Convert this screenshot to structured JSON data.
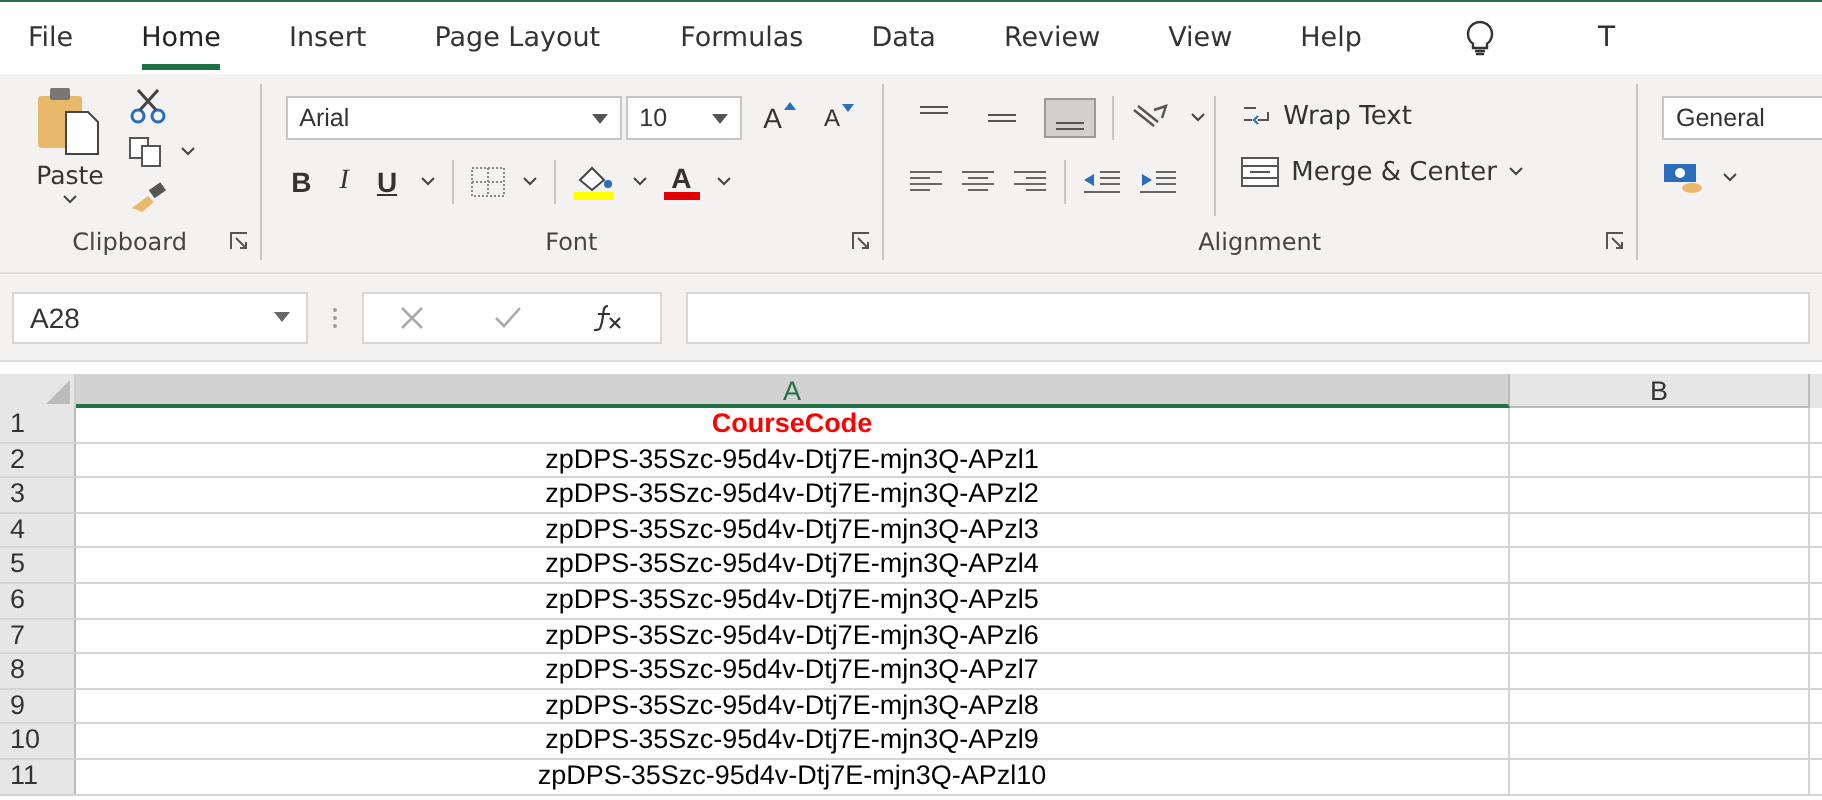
{
  "tabs": [
    {
      "label": "File",
      "selected": false
    },
    {
      "label": "Home",
      "selected": true
    },
    {
      "label": "Insert",
      "selected": false
    },
    {
      "label": "Page Layout",
      "selected": false
    },
    {
      "label": "Formulas",
      "selected": false
    },
    {
      "label": "Data",
      "selected": false
    },
    {
      "label": "Review",
      "selected": false
    },
    {
      "label": "View",
      "selected": false
    },
    {
      "label": "Help",
      "selected": false
    }
  ],
  "tell_me": "T",
  "clipboard": {
    "paste": "Paste",
    "group_label": "Clipboard"
  },
  "font": {
    "name": "Arial",
    "size": "10",
    "grow": "A",
    "shrink": "A",
    "bold": "B",
    "italic": "I",
    "underline": "U",
    "font_color": "A",
    "group_label": "Font"
  },
  "alignment": {
    "vertical": [
      {
        "selected": false
      },
      {
        "selected": false
      },
      {
        "selected": true
      }
    ],
    "wrap_text": "Wrap Text",
    "merge": "Merge & Center",
    "group_label": "Alignment"
  },
  "number": {
    "format": "General"
  },
  "name_box": "A28",
  "columns": [
    {
      "label": "A",
      "selected": true
    },
    {
      "label": "B",
      "selected": false
    }
  ],
  "rows": [
    {
      "number": "1",
      "value": "CourseCode",
      "kind": "heading"
    },
    {
      "number": "2",
      "value": "zpDPS-35Szc-95d4v-Dtj7E-mjn3Q-APzl1",
      "kind": "data"
    },
    {
      "number": "3",
      "value": "zpDPS-35Szc-95d4v-Dtj7E-mjn3Q-APzl2",
      "kind": "data"
    },
    {
      "number": "4",
      "value": "zpDPS-35Szc-95d4v-Dtj7E-mjn3Q-APzl3",
      "kind": "data"
    },
    {
      "number": "5",
      "value": "zpDPS-35Szc-95d4v-Dtj7E-mjn3Q-APzl4",
      "kind": "data"
    },
    {
      "number": "6",
      "value": "zpDPS-35Szc-95d4v-Dtj7E-mjn3Q-APzl5",
      "kind": "data"
    },
    {
      "number": "7",
      "value": "zpDPS-35Szc-95d4v-Dtj7E-mjn3Q-APzl6",
      "kind": "data"
    },
    {
      "number": "8",
      "value": "zpDPS-35Szc-95d4v-Dtj7E-mjn3Q-APzl7",
      "kind": "data"
    },
    {
      "number": "9",
      "value": "zpDPS-35Szc-95d4v-Dtj7E-mjn3Q-APzl8",
      "kind": "data"
    },
    {
      "number": "10",
      "value": "zpDPS-35Szc-95d4v-Dtj7E-mjn3Q-APzl9",
      "kind": "data"
    },
    {
      "number": "11",
      "value": "zpDPS-35Szc-95d4v-Dtj7E-mjn3Q-APzl10",
      "kind": "data"
    }
  ]
}
